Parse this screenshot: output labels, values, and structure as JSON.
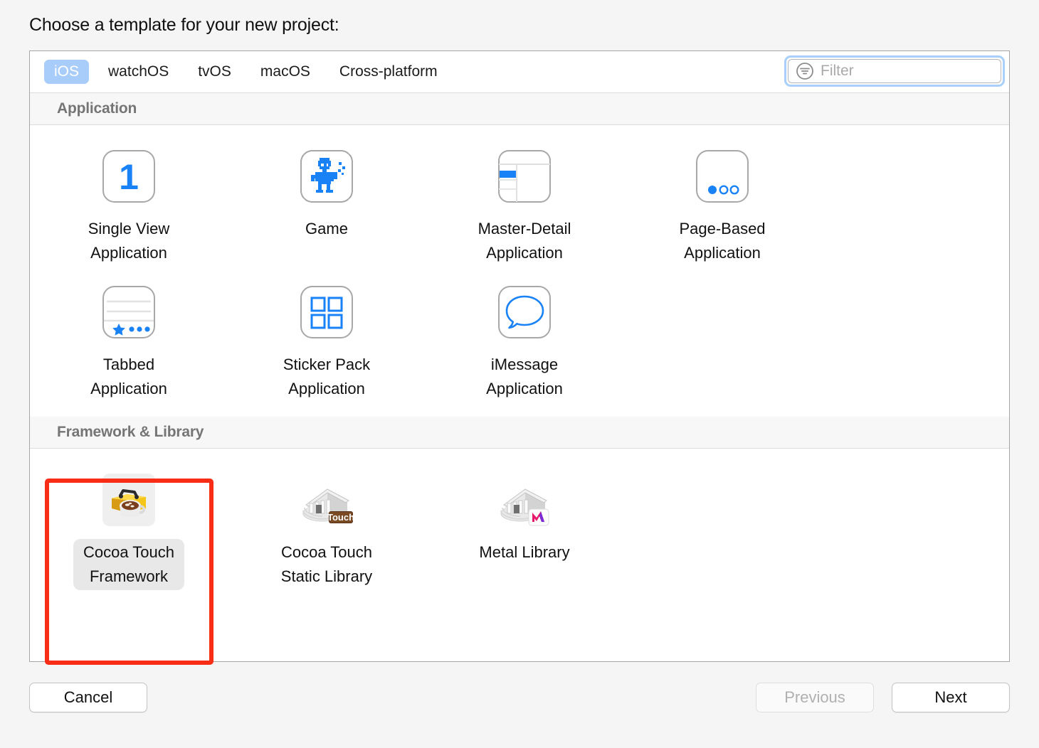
{
  "dialog": {
    "title": "Choose a template for your new project:"
  },
  "platform_tabs": [
    {
      "label": "iOS",
      "selected": true
    },
    {
      "label": "watchOS",
      "selected": false
    },
    {
      "label": "tvOS",
      "selected": false
    },
    {
      "label": "macOS",
      "selected": false
    },
    {
      "label": "Cross-platform",
      "selected": false
    }
  ],
  "filter": {
    "icon": "filter-icon",
    "value": "",
    "placeholder": "Filter",
    "focused": true,
    "focus_ring_color": "#a9d0fb"
  },
  "sections": [
    {
      "header": "Application",
      "templates": [
        {
          "label": "Single View\nApplication",
          "icon": "single-view-icon",
          "selected": false
        },
        {
          "label": "Game",
          "icon": "game-robot-icon",
          "selected": false
        },
        {
          "label": "Master-Detail\nApplication",
          "icon": "master-detail-icon",
          "selected": false
        },
        {
          "label": "Page-Based\nApplication",
          "icon": "page-based-icon",
          "selected": false
        },
        {
          "label": "Tabbed\nApplication",
          "icon": "tabbed-icon",
          "selected": false
        },
        {
          "label": "Sticker Pack\nApplication",
          "icon": "sticker-pack-icon",
          "selected": false
        },
        {
          "label": "iMessage\nApplication",
          "icon": "imessage-icon",
          "selected": false
        }
      ]
    },
    {
      "header": "Framework & Library",
      "templates": [
        {
          "label": "Cocoa Touch\nFramework",
          "icon": "toolbox-coffee-icon",
          "selected": true
        },
        {
          "label": "Cocoa Touch\nStatic Library",
          "icon": "temple-touch-icon",
          "selected": false
        },
        {
          "label": "Metal Library",
          "icon": "temple-metal-icon",
          "selected": false
        }
      ]
    }
  ],
  "annotation": {
    "shape": "rectangle",
    "color": "#f92d16",
    "target": "Cocoa Touch Framework"
  },
  "footer": {
    "cancel_label": "Cancel",
    "previous_label": "Previous",
    "previous_disabled": true,
    "next_label": "Next",
    "next_disabled": false
  },
  "colors": {
    "accent_blue": "#1a82f7",
    "tab_selected": "#a8cdfb",
    "annotation_red": "#f92d16",
    "section_header_bg": "#f7f7f7"
  }
}
